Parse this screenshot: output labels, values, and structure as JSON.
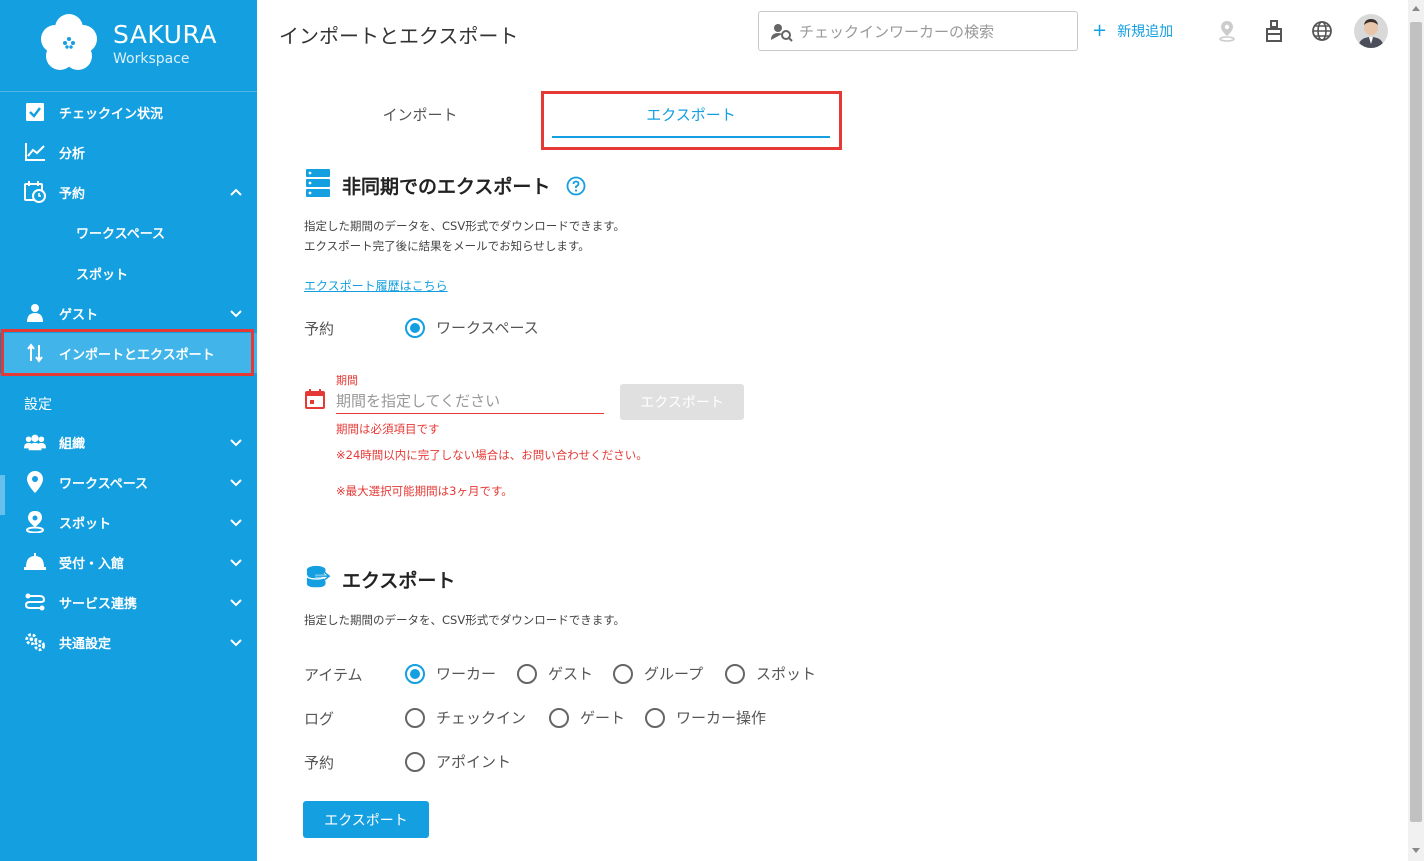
{
  "brand": {
    "name": "SAKURA",
    "sub": "Workspace"
  },
  "sidebar": {
    "items": [
      {
        "label": "チェックイン状況"
      },
      {
        "label": "分析"
      },
      {
        "label": "予約"
      },
      {
        "label": "ワークスペース"
      },
      {
        "label": "スポット"
      },
      {
        "label": "ゲスト"
      },
      {
        "label": "インポートとエクスポート"
      }
    ],
    "section": "設定",
    "settings": [
      {
        "label": "組織"
      },
      {
        "label": "ワークスペース"
      },
      {
        "label": "スポット"
      },
      {
        "label": "受付・入館"
      },
      {
        "label": "サービス連携"
      },
      {
        "label": "共通設定"
      }
    ]
  },
  "header": {
    "title": "インポートとエクスポート",
    "search_placeholder": "チェックインワーカーの検索",
    "add_new": "新規追加"
  },
  "tabs": {
    "import": "インポート",
    "export": "エクスポート"
  },
  "async_export": {
    "title": "非同期でのエクスポート",
    "desc1": "指定した期間のデータを、CSV形式でダウンロードできます。",
    "desc2": "エクスポート完了後に結果をメールでお知らせします。",
    "history_link": "エクスポート履歴はこちら",
    "reservation_label": "予約",
    "reservation_option": "ワークスペース",
    "period_label": "期間",
    "period_placeholder": "期間を指定してください",
    "export_button": "エクスポート",
    "error_required": "期間は必須項目です",
    "note1": "※24時間以内に完了しない場合は、お問い合わせください。",
    "note2": "※最大選択可能期間は3ヶ月です。"
  },
  "export": {
    "title": "エクスポート",
    "desc": "指定した期間のデータを、CSV形式でダウンロードできます。",
    "item_label": "アイテム",
    "item_options": [
      "ワーカー",
      "ゲスト",
      "グループ",
      "スポット"
    ],
    "log_label": "ログ",
    "log_options": [
      "チェックイン",
      "ゲート",
      "ワーカー操作"
    ],
    "reservation_label": "予約",
    "reservation_options": [
      "アポイント"
    ],
    "export_button": "エクスポート"
  },
  "colors": {
    "brand": "#139fe0",
    "error": "#e53935",
    "highlight": "#e53935"
  }
}
